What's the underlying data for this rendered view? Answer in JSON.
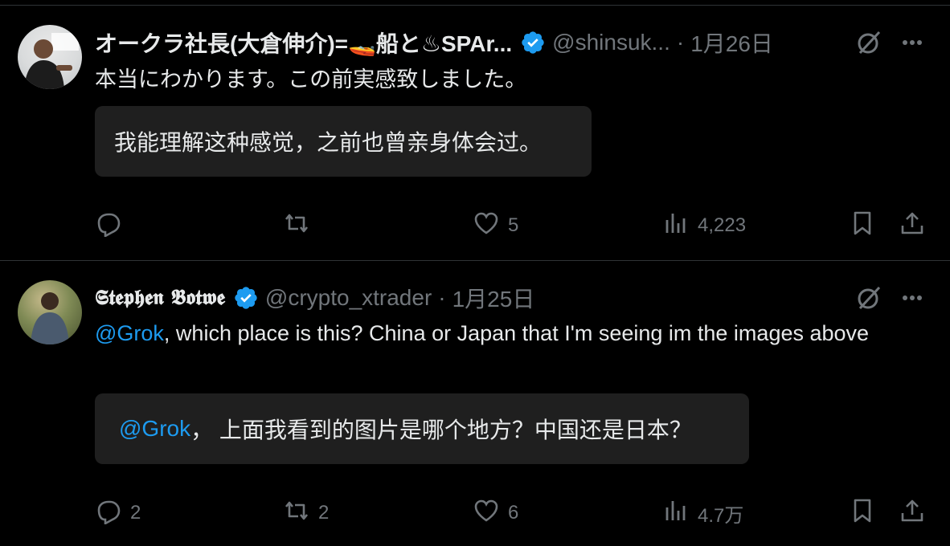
{
  "tweets": [
    {
      "author_name": "オークラ社長(大倉伸介)=🚤船と♨SPAr...",
      "handle": "@shinsuk...",
      "separator": "·",
      "date": "1月26日",
      "text": "本当にわかります。この前実感致しました。",
      "translation": "我能理解这种感觉，之前也曾亲身体会过。",
      "replies": "",
      "retweets": "",
      "likes": "5",
      "views": "4,223"
    },
    {
      "author_name": "𝕾𝖙𝖊𝖕𝖍𝖊𝖓 𝕭𝖔𝖙𝖜𝖊",
      "handle": "@crypto_xtrader",
      "separator": "·",
      "date": "1月25日",
      "text_mention": "@Grok",
      "text": ", which place is this? China or Japan that I'm seeing im the images above",
      "translation_mention": "@Grok",
      "translation": "， 上面我看到的图片是哪个地方？中国还是日本？",
      "replies": "2",
      "retweets": "2",
      "likes": "6",
      "views": "4.7万"
    }
  ],
  "colors": {
    "background": "#000000",
    "text": "#e7e9ea",
    "muted": "#71767b",
    "accent": "#1d9bf0",
    "divider": "#2f3336",
    "translation_bg": "#1f1f1f"
  },
  "icons": [
    "verified-badge-icon",
    "grok-icon",
    "more-icon",
    "reply-icon",
    "retweet-icon",
    "like-icon",
    "views-icon",
    "bookmark-icon",
    "share-icon"
  ]
}
